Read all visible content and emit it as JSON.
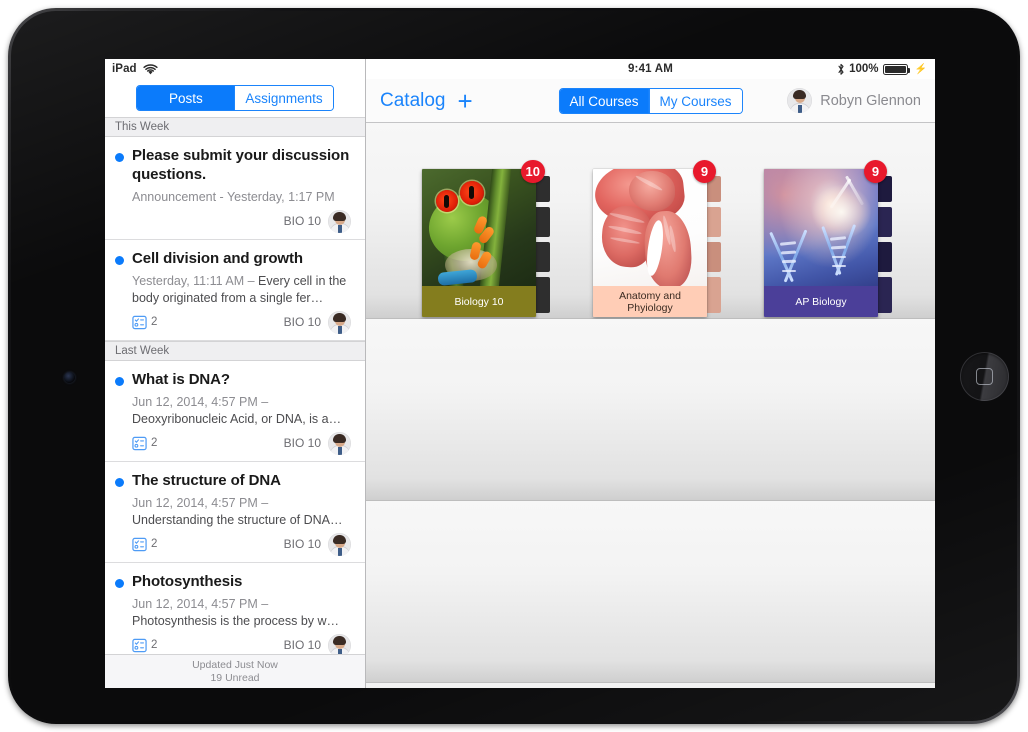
{
  "status_bar": {
    "device_label": "iPad",
    "wifi_icon": "wifi-icon",
    "clock": "9:41 AM",
    "bluetooth_icon": "bluetooth-icon",
    "battery_percent": "100%",
    "charging_icon": "lightning-bolt-icon"
  },
  "sidebar": {
    "segmented": {
      "options": [
        "Posts",
        "Assignments"
      ],
      "selected": "Posts"
    },
    "sections": [
      {
        "header": "This Week",
        "posts": [
          {
            "title": "Please submit your discussion questions.",
            "meta": "Announcement - Yesterday, 1:17 PM",
            "preview": "",
            "attachment_count": "",
            "course_code": "BIO 10",
            "unread": true
          },
          {
            "title": "Cell division and growth",
            "meta": "Yesterday, 11:11 AM – ",
            "preview": "Every cell in the body originated from a single fer…",
            "attachment_count": "2",
            "course_code": "BIO 10",
            "unread": true
          }
        ]
      },
      {
        "header": "Last Week",
        "posts": [
          {
            "title": "What is DNA?",
            "meta": "Jun 12, 2014, 4:57 PM – ",
            "preview": "Deoxyribonucleic Acid, or DNA, is a…",
            "attachment_count": "2",
            "course_code": "BIO 10",
            "unread": true
          },
          {
            "title": "The structure of DNA",
            "meta": "Jun 12, 2014, 4:57 PM – ",
            "preview": "Understanding the structure of DNA…",
            "attachment_count": "2",
            "course_code": "BIO 10",
            "unread": true
          },
          {
            "title": "Photosynthesis",
            "meta": "Jun 12, 2014, 4:57 PM – ",
            "preview": "Photosynthesis is the process by w…",
            "attachment_count": "2",
            "course_code": "BIO 10",
            "unread": true
          }
        ]
      }
    ],
    "footer": {
      "updated": "Updated Just Now",
      "unread": "19 Unread"
    }
  },
  "navbar": {
    "title": "Catalog",
    "add_icon": "plus-icon",
    "segmented": {
      "options": [
        "All Courses",
        "My Courses"
      ],
      "selected": "All Courses"
    },
    "user_name": "Robyn Glennon",
    "user_avatar": "avatar-icon"
  },
  "courses": [
    {
      "title": "Biology 10",
      "badge": "10",
      "art": "frog-on-bamboo"
    },
    {
      "title": "Anatomy and Phyiology",
      "badge": "9",
      "art": "muscle-anatomy"
    },
    {
      "title": "AP Biology",
      "badge": "9",
      "art": "dna-helix"
    }
  ],
  "colors": {
    "accent_blue": "#0b7bfb",
    "badge_red": "#e8192c",
    "biology_label": "#847d1e",
    "anatomy_label": "#ffcdb6",
    "ap_label": "#4b3f99"
  }
}
